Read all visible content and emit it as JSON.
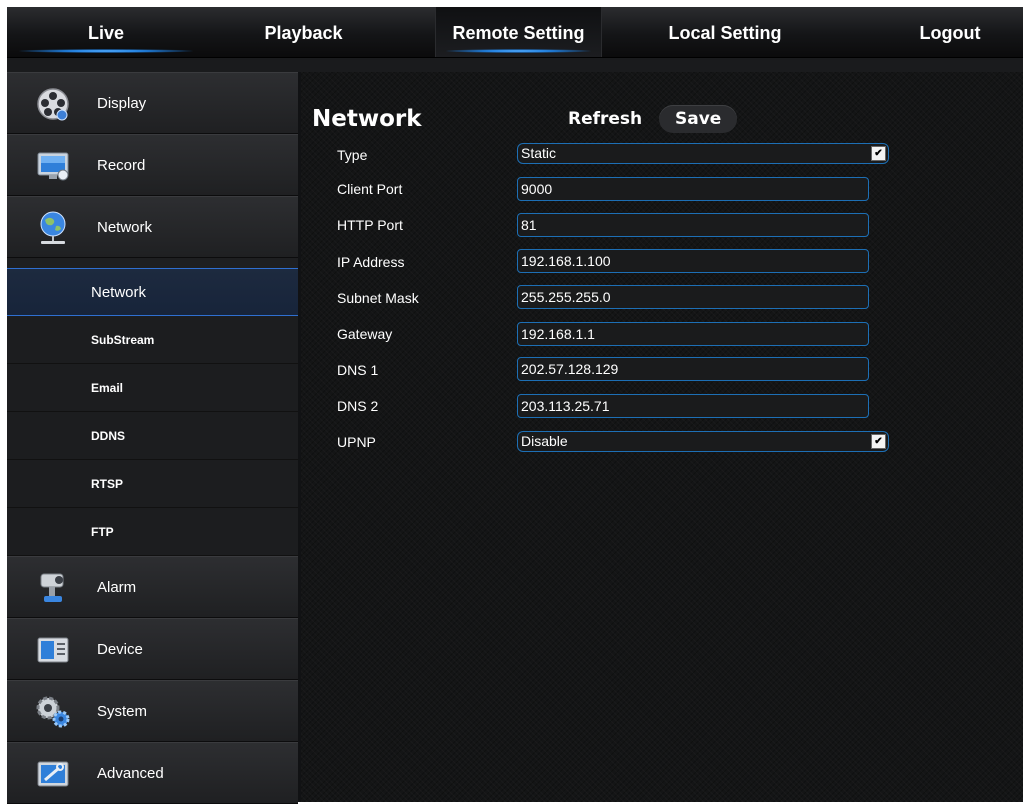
{
  "nav": {
    "tabs": [
      {
        "label": "Live"
      },
      {
        "label": "Playback"
      },
      {
        "label": "Remote Setting"
      },
      {
        "label": "Local Setting"
      },
      {
        "label": "Logout"
      }
    ],
    "active_tab": "Remote Setting"
  },
  "sidebar": {
    "menu": [
      {
        "label": "Display",
        "icon": "film-reel-icon"
      },
      {
        "label": "Record",
        "icon": "monitor-icon"
      },
      {
        "label": "Network",
        "icon": "globe-network-icon"
      },
      {
        "label": "Alarm",
        "icon": "security-camera-icon"
      },
      {
        "label": "Device",
        "icon": "hard-drive-icon"
      },
      {
        "label": "System",
        "icon": "gears-icon"
      },
      {
        "label": "Advanced",
        "icon": "advanced-tools-icon"
      }
    ],
    "network_submenu": [
      {
        "label": "Network",
        "active": true
      },
      {
        "label": "SubStream"
      },
      {
        "label": "Email"
      },
      {
        "label": "DDNS"
      },
      {
        "label": "RTSP"
      },
      {
        "label": "FTP"
      }
    ]
  },
  "main": {
    "title": "Network",
    "refresh_label": "Refresh",
    "save_label": "Save",
    "fields": {
      "type": {
        "label": "Type",
        "value": "Static"
      },
      "client_port": {
        "label": "Client Port",
        "value": "9000"
      },
      "http_port": {
        "label": "HTTP Port",
        "value": "81"
      },
      "ip_address": {
        "label": "IP Address",
        "value": "192.168.1.100"
      },
      "subnet_mask": {
        "label": "Subnet Mask",
        "value": "255.255.255.0"
      },
      "gateway": {
        "label": "Gateway",
        "value": "192.168.1.1"
      },
      "dns1": {
        "label": "DNS 1",
        "value": "202.57.128.129"
      },
      "dns2": {
        "label": "DNS 2",
        "value": "203.113.25.71"
      },
      "upnp": {
        "label": "UPNP",
        "value": "Disable"
      }
    }
  },
  "colors": {
    "accent": "#1d6fb5",
    "active_glow": "#4aa3ff",
    "background": "#141516"
  }
}
